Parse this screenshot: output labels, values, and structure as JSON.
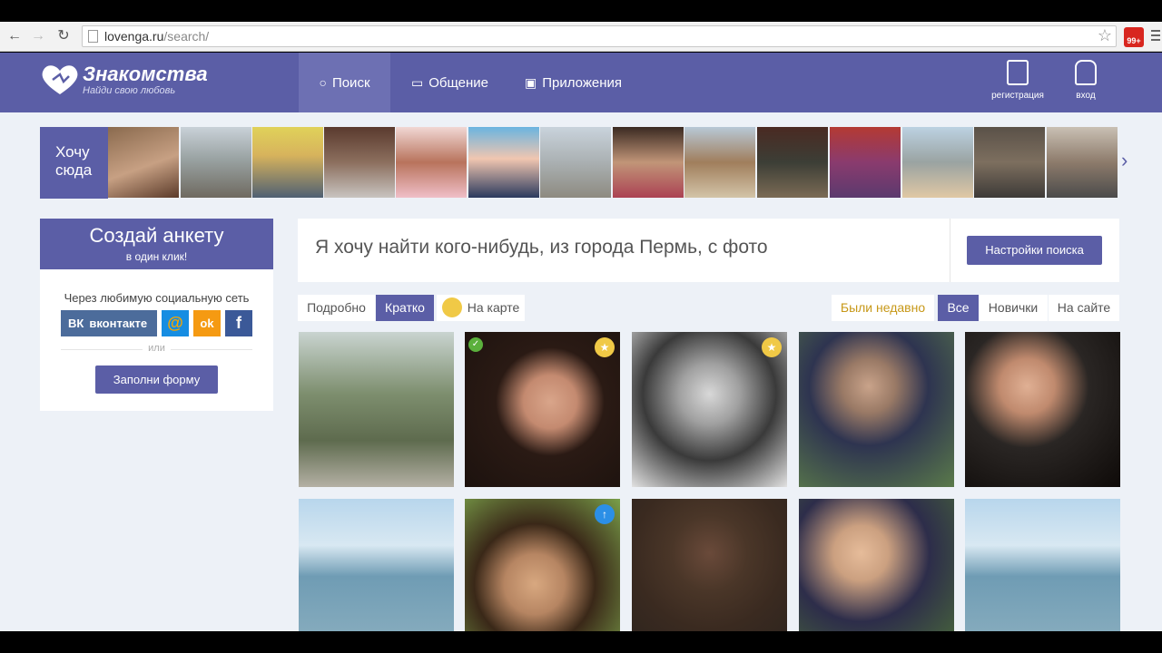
{
  "browser": {
    "url_domain": "lovenga.ru",
    "url_path": "/search/",
    "ext_badge": "99+"
  },
  "header": {
    "logo_title": "Знакомства",
    "logo_subtitle": "Найди свою любовь",
    "nav": [
      {
        "label": "Поиск",
        "icon": "search-icon"
      },
      {
        "label": "Общение",
        "icon": "chat-icon"
      },
      {
        "label": "Приложения",
        "icon": "apps-icon"
      }
    ],
    "register_label": "регистрация",
    "login_label": "вход"
  },
  "strip": {
    "want_here": "Хочу сюда",
    "photo_count_note": "profile photo carousel",
    "arrow": "›"
  },
  "create_card": {
    "title": "Создай анкету",
    "subtitle": "в один клик!",
    "social_label": "Через любимую социальную сеть",
    "vk_label": "вконтакте",
    "mail_glyph": "@",
    "ok_glyph": "ok",
    "fb_glyph": "f",
    "or_label": "или",
    "form_button": "Заполни форму"
  },
  "search": {
    "query_text": "Я хочу найти кого-нибудь, из города Пермь, с фото",
    "settings_button": "Настройки поиска"
  },
  "view_tabs": {
    "detailed": "Подробно",
    "brief": "Кратко",
    "map": "На карте"
  },
  "filter_tabs": {
    "recent": "Были недавно",
    "all": "Все",
    "newbies": "Новички",
    "online": "На сайте"
  },
  "colors": {
    "brand": "#5b5ea6",
    "recent_accent": "#c79818"
  }
}
